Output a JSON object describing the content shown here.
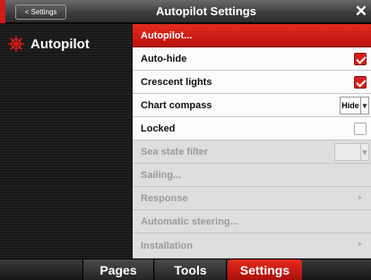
{
  "titlebar": {
    "back_label": "< Settings",
    "title": "Autopilot Settings",
    "close_symbol": "✕"
  },
  "sidebar": {
    "items": [
      {
        "label": "Autopilot",
        "icon": "helm-wheel-icon",
        "color": "#d11a1a"
      }
    ]
  },
  "settings": {
    "rows": [
      {
        "label": "Autopilot..."
      },
      {
        "label": "Auto-hide",
        "checked": true
      },
      {
        "label": "Crescent lights",
        "checked": true
      },
      {
        "label": "Chart compass",
        "value": "Hide"
      },
      {
        "label": "Locked",
        "checked": false
      },
      {
        "label": "Sea state filter",
        "value": ""
      },
      {
        "label": "Sailing..."
      },
      {
        "label": "Response"
      },
      {
        "label": "Automatic steering..."
      },
      {
        "label": "Installation"
      }
    ],
    "chevron": "▸",
    "caret": "▾"
  },
  "bottom_tabs": {
    "pages": "Pages",
    "tools": "Tools",
    "settings": "Settings"
  },
  "colors": {
    "accent_red": "#d11a1a",
    "dark_background": "#1c1c1c"
  }
}
